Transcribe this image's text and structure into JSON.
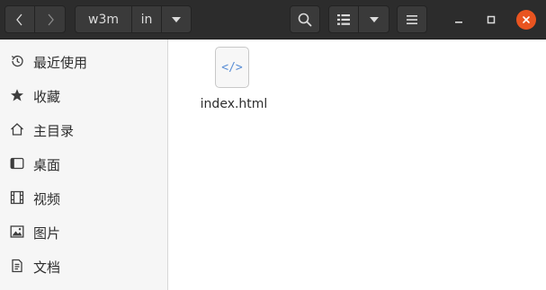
{
  "toolbar": {
    "breadcrumbs": [
      "w3m",
      "in"
    ]
  },
  "sidebar": {
    "items": [
      {
        "label": "最近使用",
        "icon": "clock-icon"
      },
      {
        "label": "收藏",
        "icon": "star-icon"
      },
      {
        "label": "主目录",
        "icon": "home-icon"
      },
      {
        "label": "桌面",
        "icon": "desktop-icon"
      },
      {
        "label": "视频",
        "icon": "film-icon"
      },
      {
        "label": "图片",
        "icon": "image-icon"
      },
      {
        "label": "文档",
        "icon": "document-icon"
      }
    ]
  },
  "files": [
    {
      "name": "index.html",
      "icon_glyph": "</>",
      "icon": "html-file-icon"
    }
  ],
  "colors": {
    "headerbar": "#2c2c2c",
    "close_button": "#e95420",
    "sidebar_bg": "#f6f6f6",
    "file_icon_accent": "#5b8fd6"
  }
}
